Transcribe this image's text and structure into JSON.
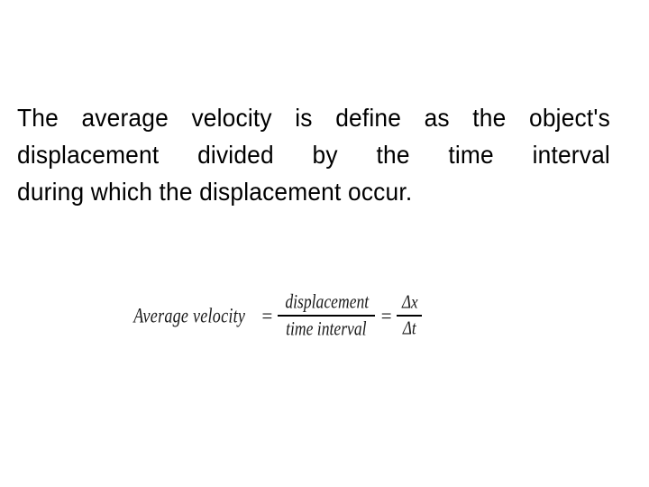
{
  "slide": {
    "background_color": "#ffffff",
    "text_color": "#000000"
  },
  "definition": {
    "full_text": "The average velocity is define as the object's displacement divided by the time interval during which the displacement occur.",
    "lines": [
      {
        "words": [
          "The",
          "average",
          "velocity",
          "is",
          "define",
          "as",
          "the",
          "object's"
        ],
        "justified": true
      },
      {
        "words": [
          "displacement",
          "divided",
          "by",
          "the",
          "time",
          "interval"
        ],
        "justified": true
      },
      {
        "words": [
          "during which the displacement occur."
        ],
        "justified": false
      }
    ]
  },
  "formula": {
    "alt": "Average velocity = displacement / time interval = delta x / delta t",
    "lhs_label": "Average velocity",
    "equals_1": "=",
    "main_fraction": {
      "numerator": "displacement",
      "denominator": "time interval"
    },
    "equals_2": "=",
    "delta_fraction": {
      "numerator": "Δx",
      "denominator": "Δt"
    }
  }
}
